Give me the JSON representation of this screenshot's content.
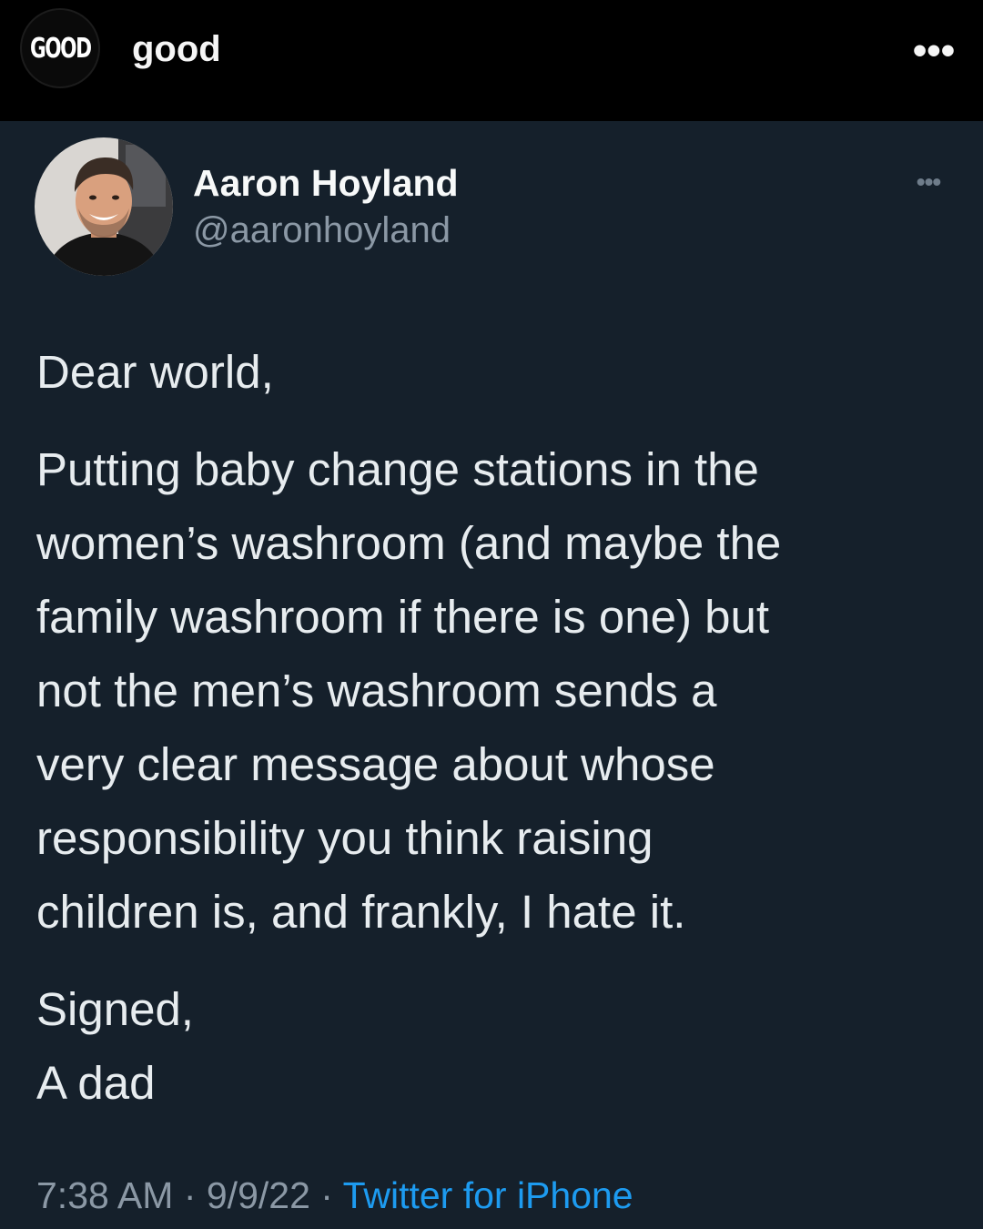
{
  "instagram": {
    "avatar_logo": "GOOD",
    "username": "good",
    "more_label": "•••"
  },
  "tweet": {
    "author_name": "Aaron Hoyland",
    "author_handle": "@aaronhoyland",
    "more_label": "•••",
    "greeting": "Dear world,",
    "body": "Putting baby change stations in the\nwomen’s washroom (and maybe the\nfamily washroom if there is one) but\nnot the men’s washroom sends a\nvery clear message about whose\nresponsibility you think raising\nchildren is, and frankly, I hate it.",
    "sign_off": "Signed,\nA dad",
    "time": "7:38 AM",
    "separator": " · ",
    "date": "9/9/22",
    "source": "Twitter for iPhone"
  },
  "colors": {
    "background": "#15202b",
    "header_background": "#000000",
    "link_blue": "#1d9bf0",
    "secondary_text": "#8b98a5"
  }
}
